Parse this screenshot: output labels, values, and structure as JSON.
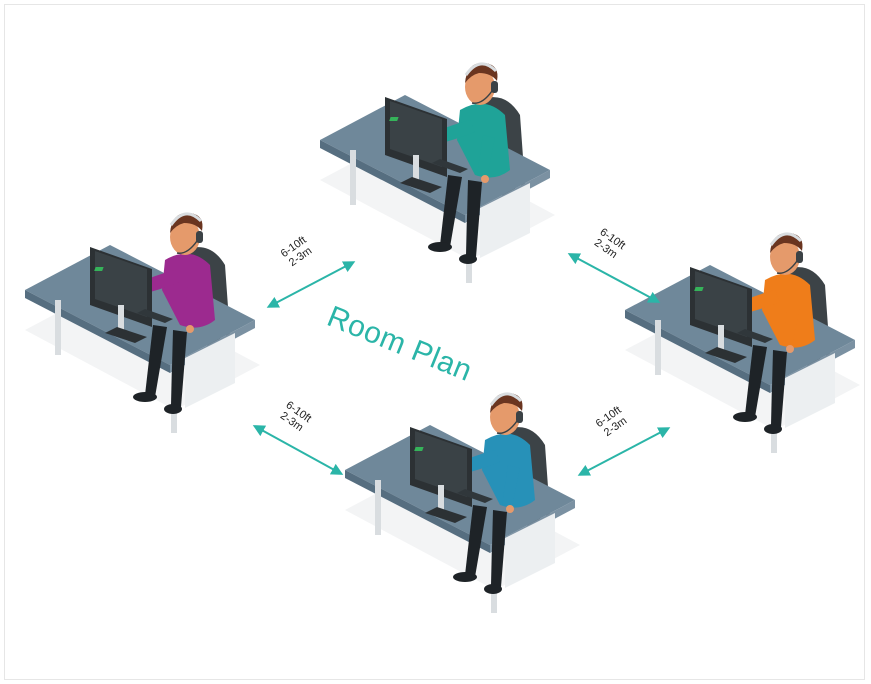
{
  "title": "Room Plan",
  "colors": {
    "accent": "#2bb5a8",
    "desk_top": "#6f889a",
    "desk_front": "#566e80",
    "monitor": "#2c3134",
    "chair": "#3c4347",
    "pants": "#1e2327",
    "skin": "#e59a6b",
    "hair": "#6a3520"
  },
  "workstations": [
    {
      "shirt_color": "#1fa398"
    },
    {
      "shirt_color": "#9c2a8f"
    },
    {
      "shirt_color": "#ef7d1a"
    },
    {
      "shirt_color": "#2791b8"
    }
  ],
  "distances": [
    {
      "feet": "6-10ft",
      "meters": "2-3m"
    },
    {
      "feet": "6-10ft",
      "meters": "2-3m"
    },
    {
      "feet": "6-10ft",
      "meters": "2-3m"
    },
    {
      "feet": "6-10ft",
      "meters": "2-3m"
    }
  ],
  "icons": [
    "headset-icon",
    "computer-monitor-icon",
    "desk-icon",
    "office-chair-icon",
    "double-arrow-icon"
  ]
}
